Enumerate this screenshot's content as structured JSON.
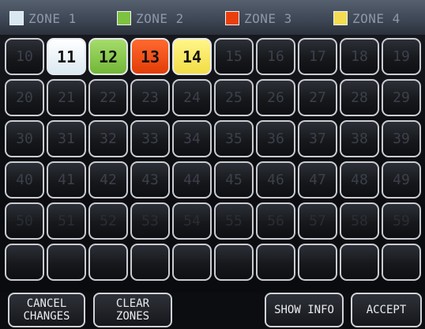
{
  "zones": [
    {
      "label": "ZONE 1",
      "color": "#d9e7f0"
    },
    {
      "label": "ZONE 2",
      "color": "#7ec241"
    },
    {
      "label": "ZONE 3",
      "color": "#ea3f0c"
    },
    {
      "label": "ZONE 4",
      "color": "#f4dc52"
    }
  ],
  "grid": {
    "rows": [
      [
        "10",
        "11",
        "12",
        "13",
        "14",
        "15",
        "16",
        "17",
        "18",
        "19"
      ],
      [
        "20",
        "21",
        "22",
        "23",
        "24",
        "25",
        "26",
        "27",
        "28",
        "29"
      ],
      [
        "30",
        "31",
        "32",
        "33",
        "34",
        "35",
        "36",
        "37",
        "38",
        "39"
      ],
      [
        "40",
        "41",
        "42",
        "43",
        "44",
        "45",
        "46",
        "47",
        "48",
        "49"
      ],
      [
        "50",
        "51",
        "52",
        "53",
        "54",
        "55",
        "56",
        "57",
        "58",
        "59"
      ],
      [
        "",
        "",
        "",
        "",
        "",
        "",
        "",
        "",
        "",
        ""
      ]
    ],
    "assigned": {
      "11": "z1",
      "12": "z2",
      "13": "z3",
      "14": "z4"
    }
  },
  "buttons": {
    "cancel": {
      "line1": "CANCEL",
      "line2": "CHANGES"
    },
    "clear": {
      "line1": "CLEAR",
      "line2": "ZONES"
    },
    "show_info": "SHOW INFO",
    "accept": "ACCEPT"
  }
}
